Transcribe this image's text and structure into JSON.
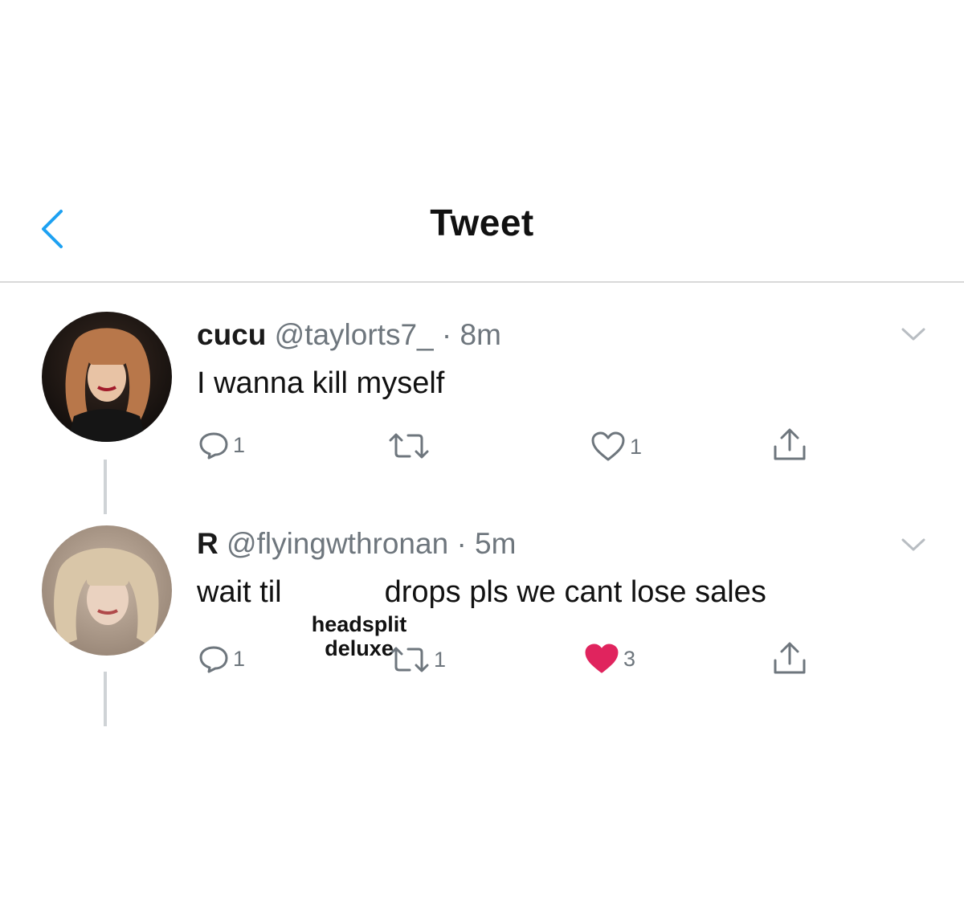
{
  "header": {
    "title": "Tweet"
  },
  "tweets": [
    {
      "display_name": "cucu",
      "handle": "@taylorts7_",
      "time": "· 8m",
      "text": "I wanna kill myself",
      "text_after": "",
      "actions": {
        "reply_count": "1",
        "retweet_count": "",
        "like_count": "1",
        "liked": false
      }
    },
    {
      "display_name": "R",
      "handle": "@flyingwthronan",
      "time": "· 5m",
      "text": "wait til",
      "text_after": "drops pls we cant lose sales",
      "actions": {
        "reply_count": "1",
        "retweet_count": "1",
        "like_count": "3",
        "liked": true
      }
    }
  ],
  "overlay": {
    "line1": "headsplit",
    "line2": "deluxe"
  },
  "colors": {
    "accent": "#1da1f2",
    "like_red": "#e0245e",
    "muted": "#6e767d",
    "divider": "#d9d9d9"
  },
  "icons": [
    "back-chevron-icon",
    "chevron-down-icon",
    "reply-icon",
    "retweet-icon",
    "heart-icon",
    "share-icon"
  ]
}
